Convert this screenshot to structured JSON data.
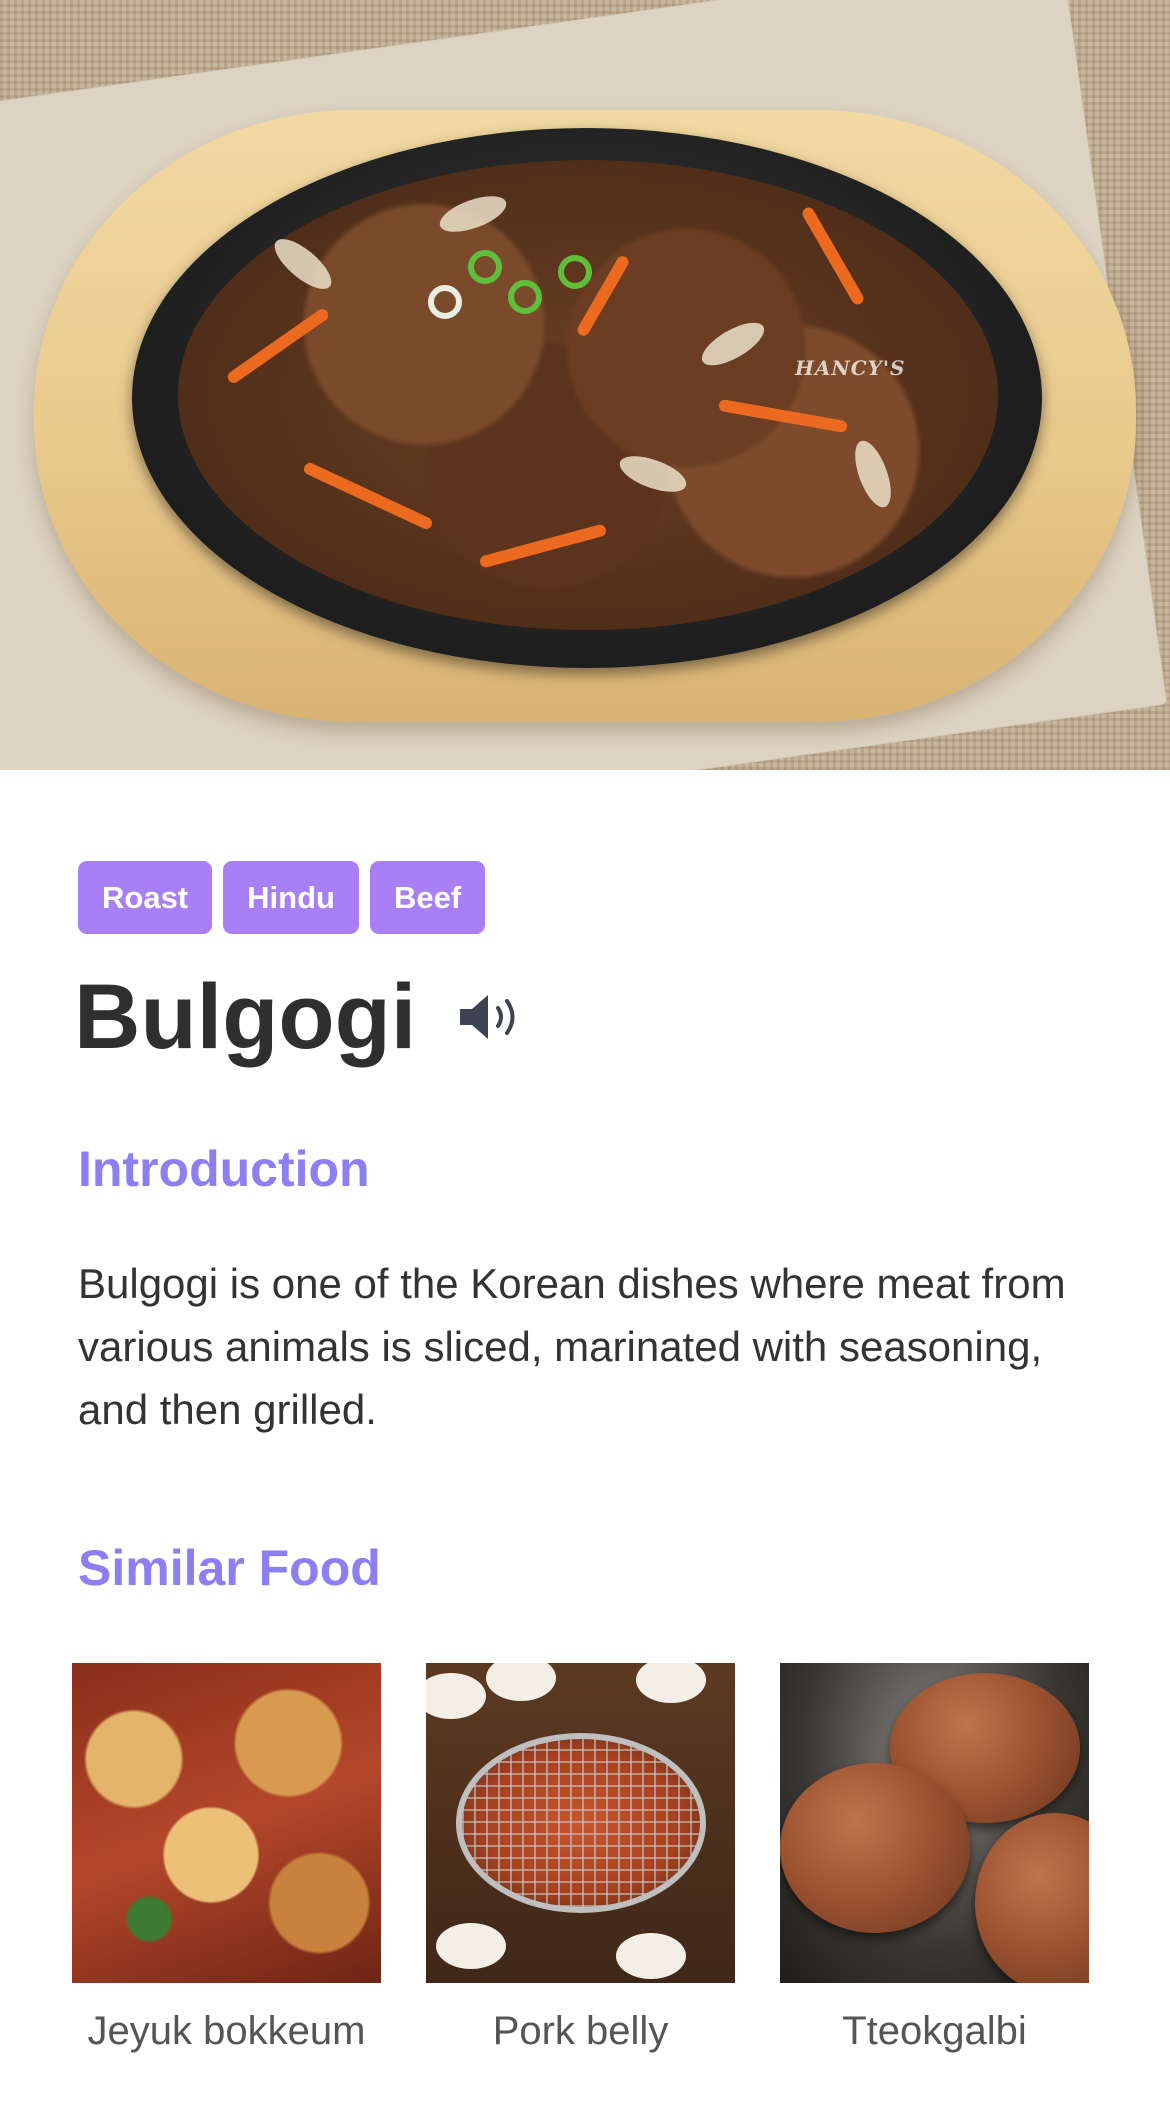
{
  "hero": {
    "image_alt": "Bulgogi on sizzling plate",
    "watermark": "HANCY'S"
  },
  "tags": [
    "Roast",
    "Hindu",
    "Beef"
  ],
  "dish": {
    "title": "Bulgogi",
    "speaker_icon": "speaker-icon"
  },
  "introduction": {
    "heading": "Introduction",
    "text": "Bulgogi is one of the Korean dishes where meat from various animals is sliced, marinated with seasoning, and then grilled."
  },
  "similar": {
    "heading": "Similar Food",
    "items": [
      {
        "label": "Jeyuk bokkeum"
      },
      {
        "label": "Pork belly"
      },
      {
        "label": "Tteokgalbi"
      }
    ]
  },
  "colors": {
    "accent": "#a97ff6",
    "heading": "#8b7ff2",
    "title": "#2f2f2f",
    "body": "#333333"
  }
}
